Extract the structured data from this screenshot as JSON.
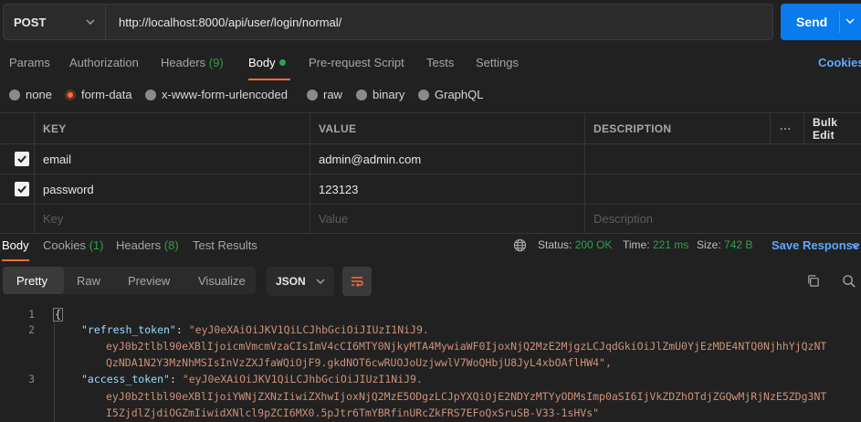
{
  "request": {
    "method": "POST",
    "url": "http://localhost:8000/api/user/login/normal/",
    "send_label": "Send"
  },
  "request_tabs": {
    "params": "Params",
    "authorization": "Authorization",
    "headers": "Headers",
    "headers_count": "(9)",
    "body": "Body",
    "prerequest": "Pre-request Script",
    "tests": "Tests",
    "settings": "Settings",
    "cookies": "Cookies"
  },
  "body_types": {
    "none": "none",
    "form_data": "form-data",
    "urlencoded": "x-www-form-urlencoded",
    "raw": "raw",
    "binary": "binary",
    "graphql": "GraphQL",
    "selected": "form-data"
  },
  "params_table": {
    "headers": {
      "key": "KEY",
      "value": "VALUE",
      "description": "DESCRIPTION",
      "more": "···",
      "bulk_edit": "Bulk Edit"
    },
    "rows": [
      {
        "key": "email",
        "value": "admin@admin.com",
        "description": "",
        "checked": true
      },
      {
        "key": "password",
        "value": "123123",
        "description": "",
        "checked": true
      }
    ],
    "placeholder": {
      "key": "Key",
      "value": "Value",
      "description": "Description"
    }
  },
  "response_tabs": {
    "body": "Body",
    "cookies": "Cookies",
    "cookies_count": "(1)",
    "headers": "Headers",
    "headers_count": "(8)",
    "test_results": "Test Results"
  },
  "response_status": {
    "status_label": "Status:",
    "status_value": "200 OK",
    "time_label": "Time:",
    "time_value": "221 ms",
    "size_label": "Size:",
    "size_value": "742 B",
    "save_response": "Save Response"
  },
  "view_modes": {
    "pretty": "Pretty",
    "raw": "Raw",
    "preview": "Preview",
    "visualize": "Visualize",
    "format": "JSON"
  },
  "code": {
    "lines": [
      "1",
      "2",
      "3"
    ],
    "open_brace": "{",
    "refresh_key": "\"refresh_token\"",
    "refresh_line1": "\"eyJ0eXAiOiJKV1QiLCJhbGciOiJIUzI1NiJ9.",
    "refresh_line2": "eyJ0b2tlbl90eXBlIjoicmVmcmVzaCIsImV4cCI6MTY0NjkyMTA4MywiaWF0IjoxNjQ2MzE2MjgzLCJqdGkiOiJlZmU0YjEzMDE4NTQ0NjhhYjQzNT",
    "refresh_line3": "QzNDA1N2Y3MzNhMSIsInVzZXJfaWQiOjF9.gkdNOT6cwRUOJoUzjwwlV7WoQHbjU8JyL4xbOAflHW4\",",
    "access_key": "\"access_token\"",
    "access_line1": "\"eyJ0eXAiOiJKV1QiLCJhbGciOiJIUzI1NiJ9.",
    "access_line2": "eyJ0b2tlbl90eXBlIjoiYWNjZXNzIiwiZXhwIjoxNjQ2MzE5ODgzLCJpYXQiOjE2NDYzMTYyODMsImp0aSI6IjVkZDZhOTdjZGQwMjRjNzE5ZDg3NT",
    "access_line3": "I5ZjdlZjdiOGZmIiwidXNlcl9pZCI6MX0.5pJtr6TmYBRfinURcZkFRS7EFoQxSruSB-V33-1sHVs\""
  },
  "colors": {
    "accent": "#ff6c37",
    "send": "#097bed",
    "link": "#5ca9fb",
    "success": "#2fa14b"
  }
}
